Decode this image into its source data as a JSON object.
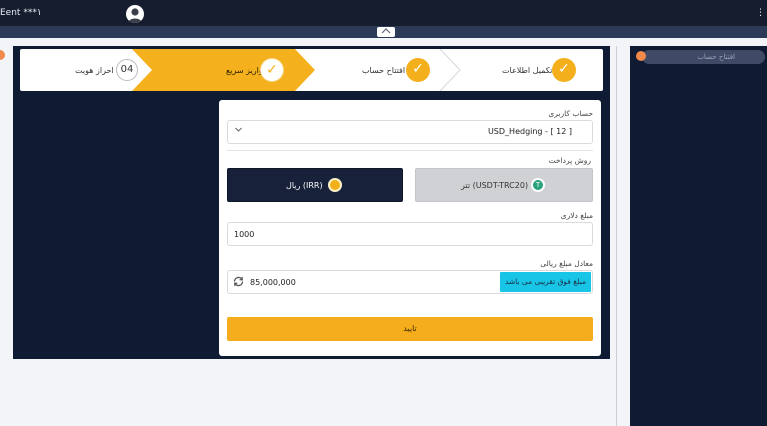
{
  "header": {
    "account_label": "Eent ***١",
    "menu_glyph": "⋮"
  },
  "sidebar_right": {
    "item_label": "افتتاح حساب"
  },
  "stepper": {
    "steps": [
      {
        "label": "تکمیل اطلاعات",
        "state": "done"
      },
      {
        "label": "افتتاح حساب",
        "state": "done"
      },
      {
        "label": "واریز سریع",
        "state": "active"
      },
      {
        "label": "احراز هویت",
        "state": "pending",
        "number": "04"
      }
    ],
    "check_glyph": "✓"
  },
  "form": {
    "account_label": "حساب کاربری",
    "account_value": "USD_Hedging - [ 12        ]",
    "payment_method_label": "روش پرداخت",
    "pay_irr_label": "ریال (IRR)",
    "pay_usdt_label": "تتر (USDT-TRC20)",
    "usd_amount_label": "مبلغ دلاری",
    "usd_amount_value": "1000",
    "rial_equiv_label": "معادل مبلغ ریالی",
    "rial_equiv_value": "85,000,000",
    "approx_note": "مبلغ فوق تقریبی می باشد",
    "confirm_label": "تایید"
  },
  "colors": {
    "accent": "#f5ad1d",
    "navy": "#0f1a33",
    "info": "#19c5e6",
    "tether": "#26a17b"
  }
}
